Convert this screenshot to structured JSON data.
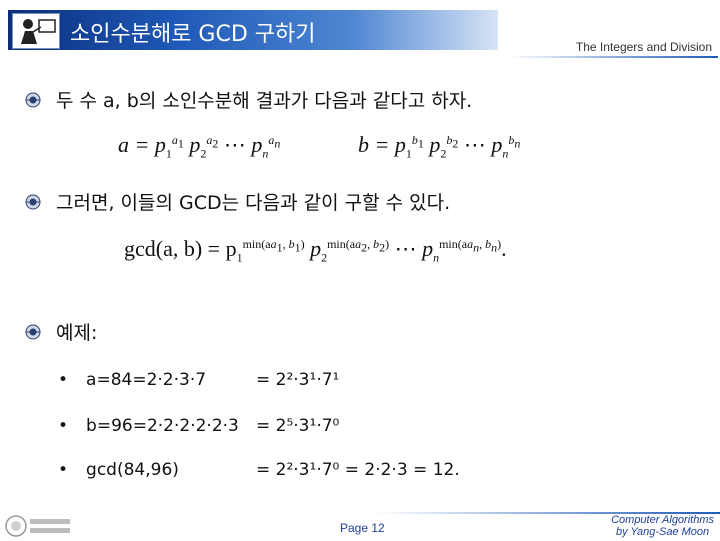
{
  "header": {
    "title": "소인수분해로 GCD 구하기",
    "subject": "The Integers and Division"
  },
  "bullets": [
    {
      "text": "두 수 a, b의 소인수분해 결과가 다음과 같다고 하자."
    },
    {
      "text": "그러면, 이들의 GCD는 다음과 같이 구할 수 있다."
    },
    {
      "text": "예제:"
    }
  ],
  "formulas": {
    "a_lhs": "a = p",
    "b_lhs": "b = p",
    "gcd_lhs": "gcd(a, b) = p",
    "ellipsis": "⋯",
    "gcd_min1": "min(a",
    "gcd_min2": "min(a",
    "gcd_minn": "min(a"
  },
  "examples": [
    {
      "left": "a=84=2·2·3·7",
      "right": "= 2²·3¹·7¹"
    },
    {
      "left": "b=96=2·2·2·2·2·3",
      "right": "= 2⁵·3¹·7⁰"
    },
    {
      "left": "gcd(84,96)",
      "right": "= 2²·3¹·7⁰ = 2·2·3 = 12."
    }
  ],
  "footer": {
    "page": "Page 12",
    "credit_line1": "Computer Algorithms",
    "credit_line2": "by Yang-Sae Moon",
    "logo_text": "강원대학교 컴퓨터과학과"
  },
  "colors": {
    "title_bar": "#1f5ab8",
    "footer_text": "#1f3f9a"
  }
}
